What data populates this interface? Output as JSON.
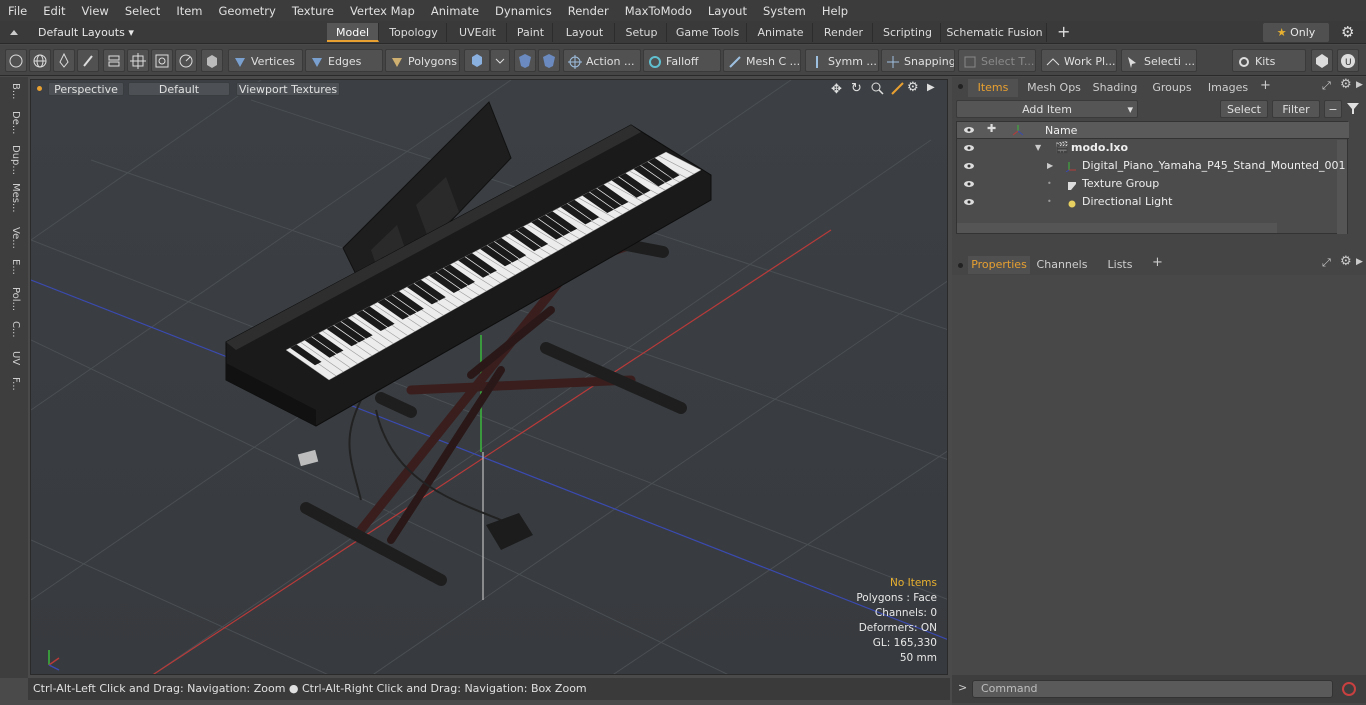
{
  "menu": [
    "File",
    "Edit",
    "View",
    "Select",
    "Item",
    "Geometry",
    "Texture",
    "Vertex Map",
    "Animate",
    "Dynamics",
    "Render",
    "MaxToModo",
    "Layout",
    "System",
    "Help"
  ],
  "layout_selector": "Default Layouts",
  "tabs": [
    "Model",
    "Topology",
    "UVEdit",
    "Paint",
    "Layout",
    "Setup",
    "Game Tools",
    "Animate",
    "Render",
    "Scripting",
    "Schematic Fusion"
  ],
  "only_label": "Only",
  "toolbar": {
    "vertices": "Vertices",
    "edges": "Edges",
    "polygons": "Polygons",
    "action": "Action ...",
    "falloff": "Falloff",
    "mesh": "Mesh C ...",
    "symm": "Symm ...",
    "snapping": "Snapping",
    "select_t": "Select T...",
    "work_pl": "Work Pl...",
    "selecti": "Selecti ...",
    "kits": "Kits"
  },
  "left_tabs": [
    "B...",
    "De...",
    "Dup...",
    "Mes...",
    "Ve...",
    "E...",
    "Pol...",
    "C...",
    "UV",
    "F..."
  ],
  "viewport": {
    "view_mode": "Perspective",
    "shading": "Default",
    "textures": "Viewport Textures"
  },
  "hud": {
    "no_items": "No Items",
    "polygons": "Polygons : Face",
    "channels": "Channels: 0",
    "deformers": "Deformers: ON",
    "gl": "GL: 165,330",
    "unit": "50 mm"
  },
  "status": "Ctrl-Alt-Left Click and Drag: Navigation: Zoom ● Ctrl-Alt-Right Click and Drag: Navigation: Box Zoom",
  "panel_tabs": [
    "Items",
    "Mesh Ops",
    "Shading",
    "Groups",
    "Images"
  ],
  "add_item": "Add Item",
  "select_btn": "Select",
  "filter_btn": "Filter",
  "name_col": "Name",
  "items": [
    {
      "name": "modo.lxo"
    },
    {
      "name": "Digital_Piano_Yamaha_P45_Stand_Mounted_001"
    },
    {
      "name": "Texture Group"
    },
    {
      "name": "Directional Light"
    }
  ],
  "props_tabs": [
    "Properties",
    "Channels",
    "Lists"
  ],
  "command_placeholder": "Command",
  "colors": {
    "accent": "#e8a030",
    "viewport_bg": "#3b3f43"
  }
}
